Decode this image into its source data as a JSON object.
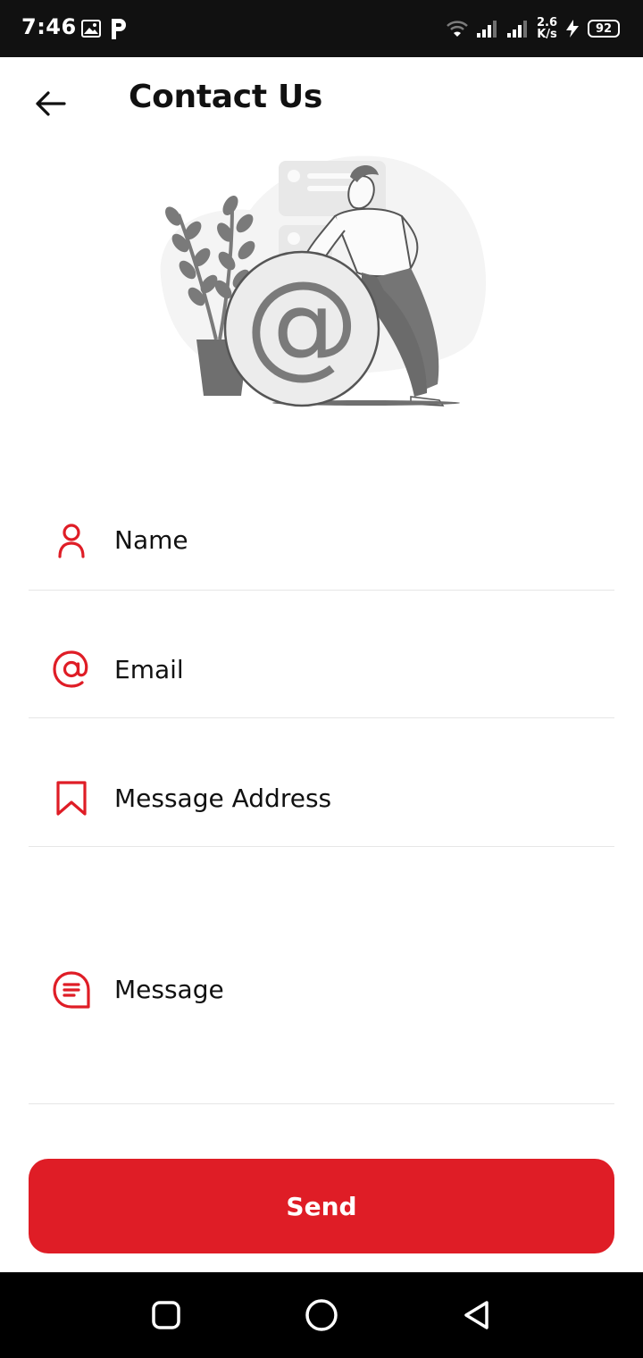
{
  "status_bar": {
    "time": "7:46",
    "net_speed_value": "2.6",
    "net_speed_unit": "K/s",
    "battery": "92"
  },
  "header": {
    "title": "Contact Us",
    "back_icon": "arrow-left-icon"
  },
  "form": {
    "name": {
      "placeholder": "Name",
      "icon": "person-icon"
    },
    "email": {
      "placeholder": "Email",
      "icon": "at-sign-icon"
    },
    "message_address": {
      "placeholder": "Message Address",
      "icon": "bookmark-icon"
    },
    "message": {
      "placeholder": "Message",
      "icon": "chat-lines-icon"
    }
  },
  "send_button": {
    "label": "Send"
  },
  "colors": {
    "accent": "#df1d26",
    "text": "#111111",
    "divider": "#e6e6e6",
    "illustration_gray": "#7a7a7a"
  }
}
